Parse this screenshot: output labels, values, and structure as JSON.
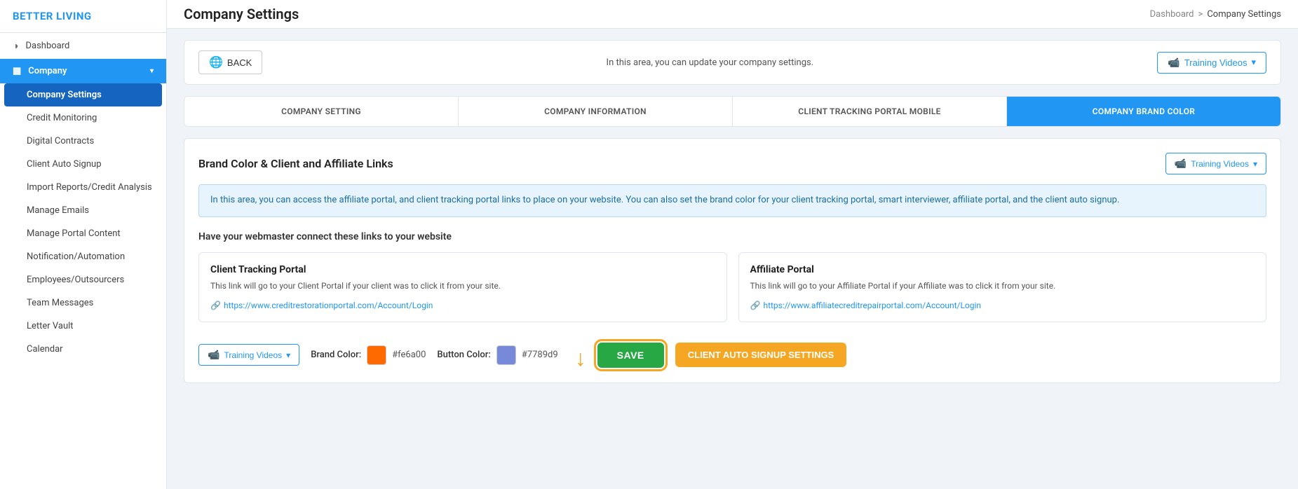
{
  "sidebar": {
    "logo": "BETTER LIVING",
    "items": [
      {
        "id": "dashboard",
        "label": "Dashboard",
        "icon": "◑",
        "active": false
      },
      {
        "id": "company",
        "label": "Company",
        "icon": "▦",
        "active": true,
        "expanded": true,
        "arrow": "▾"
      }
    ],
    "sub_items": [
      {
        "id": "company-settings",
        "label": "Company Settings",
        "active": true
      },
      {
        "id": "credit-monitoring",
        "label": "Credit Monitoring",
        "active": false
      },
      {
        "id": "digital-contracts",
        "label": "Digital Contracts",
        "active": false
      },
      {
        "id": "client-auto-signup",
        "label": "Client Auto Signup",
        "active": false
      },
      {
        "id": "import-reports",
        "label": "Import Reports/Credit Analysis",
        "active": false
      },
      {
        "id": "manage-emails",
        "label": "Manage Emails",
        "active": false
      },
      {
        "id": "manage-portal",
        "label": "Manage Portal Content",
        "active": false
      },
      {
        "id": "notification",
        "label": "Notification/Automation",
        "active": false
      },
      {
        "id": "employees",
        "label": "Employees/Outsourcers",
        "active": false
      },
      {
        "id": "team-messages",
        "label": "Team Messages",
        "active": false
      },
      {
        "id": "letter-vault",
        "label": "Letter Vault",
        "active": false
      },
      {
        "id": "calendar",
        "label": "Calendar",
        "active": false
      }
    ]
  },
  "header": {
    "title": "Company Settings",
    "breadcrumb": {
      "dashboard": "Dashboard",
      "separator": ">",
      "current": "Company Settings"
    }
  },
  "back_bar": {
    "back_label": "BACK",
    "info_text": "In this area, you can update your company settings.",
    "training_label": "Training Videos",
    "training_arrow": "▾"
  },
  "tabs": [
    {
      "id": "company-setting",
      "label": "COMPANY SETTING",
      "active": false
    },
    {
      "id": "company-information",
      "label": "COMPANY INFORMATION",
      "active": false
    },
    {
      "id": "client-tracking",
      "label": "CLIENT TRACKING PORTAL MOBILE",
      "active": false
    },
    {
      "id": "company-brand-color",
      "label": "COMPANY BRAND COLOR",
      "active": true
    }
  ],
  "brand_color_section": {
    "title": "Brand Color & Client and Affiliate Links",
    "training_label": "Training Videos",
    "training_arrow": "▾",
    "info_text": "In this area, you can access the affiliate portal, and client tracking portal links to place on your website. You can also set the brand color for your client tracking portal, smart interviewer, affiliate portal, and the client auto signup.",
    "section_heading": "Have your webmaster connect these links to your website",
    "client_portal": {
      "title": "Client Tracking Portal",
      "description": "This link will go to your Client Portal if your client was to click it from your site.",
      "link": "https://www.creditrestorationportal.com/Account/Login"
    },
    "affiliate_portal": {
      "title": "Affiliate Portal",
      "description": "This link will go to your Affiliate Portal if your Affiliate was to click it from your site.",
      "link": "https://www.affiliatecreditrepairportal.com/Account/Login"
    },
    "controls": {
      "training_label": "Training Videos",
      "training_arrow": "▾",
      "brand_color_label": "Brand Color:",
      "brand_color_value": "#fe6a00",
      "brand_color_hex": "#fe6a00",
      "button_color_label": "Button Color:",
      "button_color_value": "#7789d9",
      "button_color_hex": "#7789d9",
      "save_label": "SAVE",
      "client_signup_label": "CLIENT AUTO SIGNUP SETTINGS"
    }
  }
}
